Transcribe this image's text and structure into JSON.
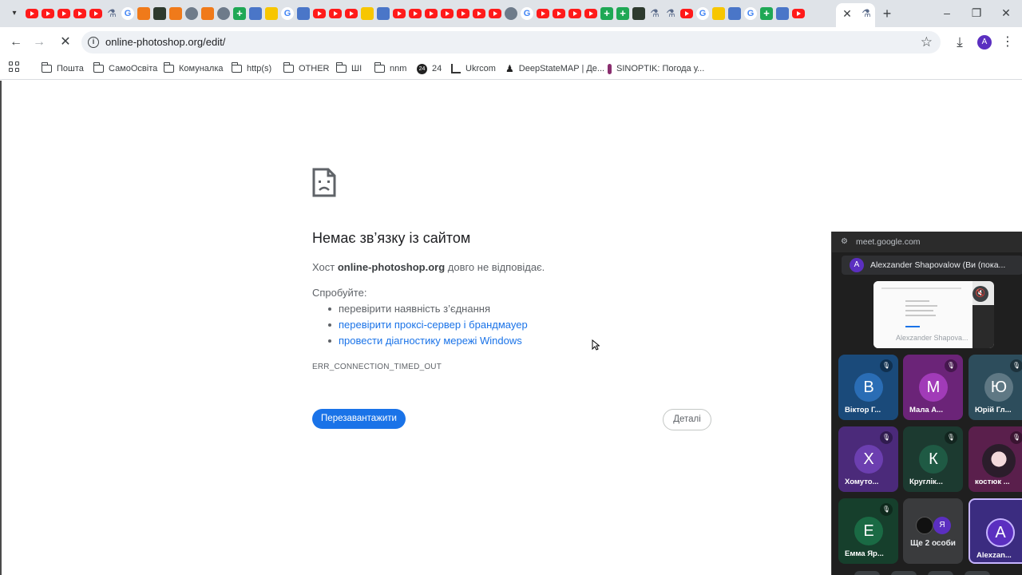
{
  "browser": {
    "url": "online-photoshop.org/edit/",
    "profile_initial": "A",
    "tab_icons": [
      "yt",
      "yt",
      "yt",
      "yt",
      "yt",
      "flask",
      "g",
      "orange",
      "dark",
      "orange",
      "gray",
      "orange",
      "gray",
      "green",
      "blue",
      "yellow",
      "g",
      "blue",
      "yt",
      "yt",
      "yt",
      "yellow",
      "blue",
      "yt",
      "yt",
      "yt",
      "yt",
      "yt",
      "yt",
      "yt",
      "gray",
      "g",
      "yt",
      "yt",
      "yt",
      "yt",
      "green",
      "green",
      "dark",
      "flask",
      "flask",
      "yt",
      "g",
      "yellow",
      "blue",
      "g",
      "green",
      "blue",
      "yt"
    ]
  },
  "bookmarks": [
    {
      "kind": "folder",
      "label": "Пошта"
    },
    {
      "kind": "folder",
      "label": "СамоОсвіта"
    },
    {
      "kind": "folder",
      "label": "Комуналка"
    },
    {
      "kind": "folder",
      "label": "http(s)"
    },
    {
      "kind": "folder",
      "label": "OTHER"
    },
    {
      "kind": "folder",
      "label": "ШІ"
    },
    {
      "kind": "folder",
      "label": "nnm"
    },
    {
      "kind": "round",
      "label": "24",
      "icon_text": "24"
    },
    {
      "kind": "chart",
      "label": "Ukrcom"
    },
    {
      "kind": "pawn",
      "label": "DeepStateMAP | Де..."
    },
    {
      "kind": "thermo",
      "label": "SINOPTIK: Погода у..."
    }
  ],
  "error": {
    "title": "Немає зв’язку із сайтом",
    "host_prefix": "Хост ",
    "host_name": "online-photoshop.org",
    "host_suffix": " довго не відповідає.",
    "try_label": "Спробуйте:",
    "suggestions": [
      {
        "text": "перевірити наявність з’єднання",
        "link": false
      },
      {
        "text": "перевірити проксі-сервер і брандмауер",
        "link": true
      },
      {
        "text": "провести діагностику мережі Windows",
        "link": true
      }
    ],
    "code": "ERR_CONNECTION_TIMED_OUT",
    "reload_label": "Перезавантажити",
    "details_label": "Деталі"
  },
  "meet": {
    "url": "meet.google.com",
    "presenter_initial": "A",
    "presenter_label": "Alexzander Shapovalow (Ви (пока...",
    "share_name": "Alexzander Shapova...",
    "tiles": [
      {
        "initial": "В",
        "name": "Віктор Г...",
        "color": "#1a4a7a",
        "avatar": "#2a6db5",
        "muted": true
      },
      {
        "initial": "М",
        "name": "Мала А...",
        "color": "#6b2478",
        "avatar": "#a13bb8",
        "muted": true
      },
      {
        "initial": "Ю",
        "name": "Юрій Гл...",
        "color": "#2d4d5c",
        "avatar": "#5f7884",
        "muted": true
      },
      {
        "initial": "Х",
        "name": "Хомуто...",
        "color": "#4b2a7a",
        "avatar": "#6c3fb0",
        "muted": true
      },
      {
        "initial": "К",
        "name": "Круглік...",
        "color": "#1c3a30",
        "avatar": "#1f5a44",
        "muted": true
      },
      {
        "initial": "",
        "name": "костюк ...",
        "color": "#5a1f4c",
        "avatar": "",
        "muted": true,
        "photo": true
      },
      {
        "initial": "Е",
        "name": "Емма Яр...",
        "color": "#163f2c",
        "avatar": "#1a6a44",
        "muted": true
      },
      {
        "initial": "",
        "name": "",
        "color": "#3a3b3d",
        "avatar": "",
        "muted": false,
        "more": true
      },
      {
        "initial": "A",
        "name": "Alexzan...",
        "color": "#3b2c80",
        "avatar": "#5b2fc0",
        "muted": false,
        "active": true
      }
    ],
    "more_initial": "Я",
    "more_label": "Ще 2 особи"
  }
}
